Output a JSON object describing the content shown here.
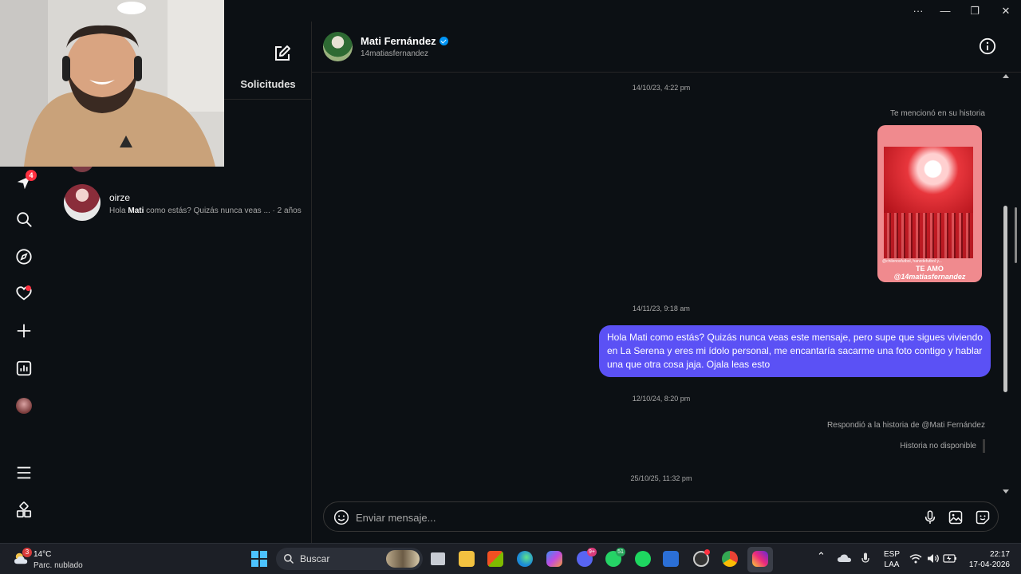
{
  "window": {
    "controls": {
      "more": "···",
      "minimize": "—",
      "maximize": "❐",
      "close": "✕"
    }
  },
  "rail": {
    "messages_badge": "4",
    "items": [
      "messages-icon",
      "search-icon",
      "explore-icon",
      "notifications-icon",
      "create-icon",
      "dashboard-icon",
      "profile-avatar",
      "menu-icon",
      "more-apps-icon"
    ]
  },
  "list": {
    "requests_tab": "Solicitudes",
    "conversations": [
      {
        "name": "oirze",
        "preview_prefix": "Hola ",
        "preview_bold": "Mati",
        "preview_rest": " como estás? Quizás nunca veas ...",
        "time": " · 2 años"
      }
    ]
  },
  "chat": {
    "name": "Mati Fernández",
    "handle": "14matiasfernandez",
    "messages": {
      "stamp1": "14/10/23, 4:22 pm",
      "mention_label": "Te mencionó en su historia",
      "story_small": "@chilenosfutbol, hanzdefutbol y...",
      "story_line1": "TE AMO",
      "story_line2": "@14matiasfernandez",
      "stamp2": "14/11/23, 9:18 am",
      "bubble": "Hola Mati como estás? Quizás nunca veas este mensaje, pero supe que sigues viviendo en La Serena y eres mi ídolo personal, me encantaría sacarme una foto contigo y hablar una que otra cosa jaja. Ojala leas esto",
      "stamp3": "12/10/24, 8:20 pm",
      "reply_label": "Respondió a la historia de @Mati Fernández",
      "unavailable": "Historia no disponible",
      "stamp4": "25/10/25, 11:32 pm"
    },
    "composer_placeholder": "Enviar mensaje..."
  },
  "taskbar": {
    "weather_badge": "3",
    "weather_temp": "14°C",
    "weather_desc": "Parc. nublado",
    "search_label": "Buscar",
    "discord_badge": "9+",
    "whatsapp_badge": "51",
    "lang_top": "ESP",
    "lang_bottom": "LAA",
    "time": "22:17",
    "date": "17-04-2026"
  },
  "colors": {
    "background": "#0c1014",
    "bubble": "#5b51f5",
    "badge": "#ff3040",
    "verified": "#0095f6"
  }
}
